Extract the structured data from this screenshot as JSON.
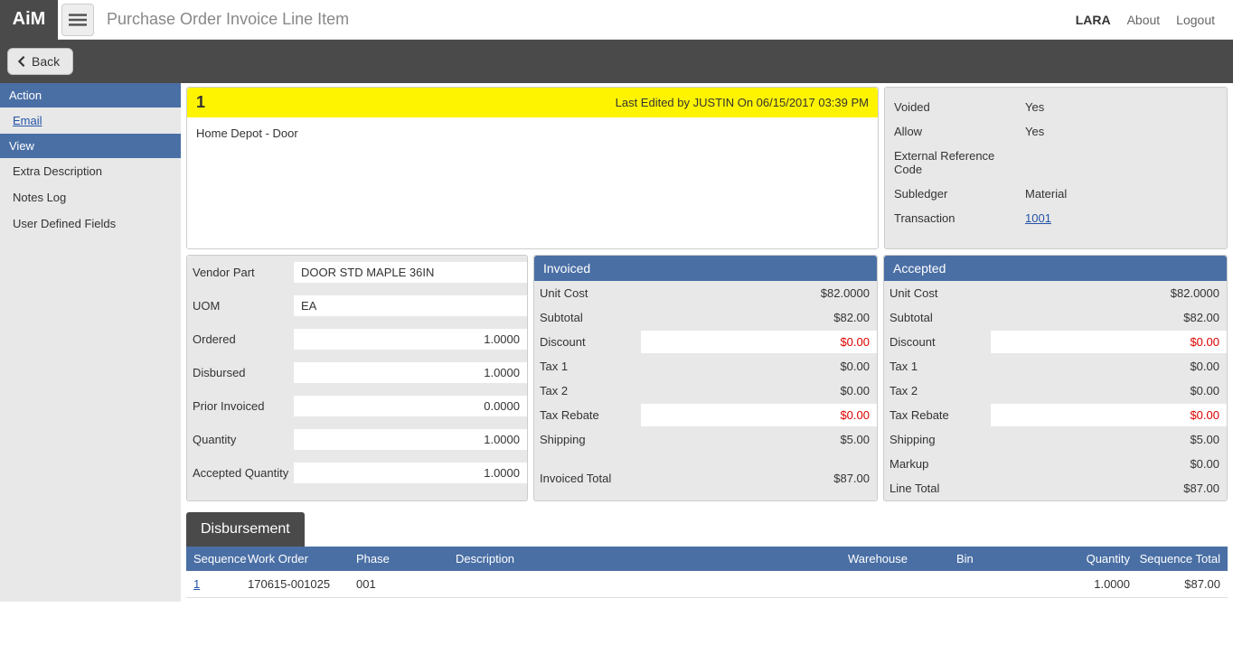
{
  "app": {
    "logo": "AiM",
    "title": "Purchase Order Invoice Line Item"
  },
  "top": {
    "user": "LARA",
    "about": "About",
    "logout": "Logout"
  },
  "back": "Back",
  "sidebar": {
    "action_header": "Action",
    "email": "Email",
    "view_header": "View",
    "extra_desc": "Extra Description",
    "notes_log": "Notes Log",
    "udf": "User Defined Fields"
  },
  "header": {
    "number": "1",
    "edited": "Last Edited by JUSTIN On 06/15/2017 03:39 PM",
    "desc": "Home Depot - Door"
  },
  "info": {
    "voided_l": "Voided",
    "voided_v": "Yes",
    "allow_l": "Allow",
    "allow_v": "Yes",
    "ext_l": "External Reference Code",
    "ext_v": "",
    "sub_l": "Subledger",
    "sub_v": "Material",
    "trans_l": "Transaction",
    "trans_v": "1001"
  },
  "left": {
    "vendor_l": "Vendor Part",
    "vendor_v": "DOOR STD MAPLE 36IN",
    "uom_l": "UOM",
    "uom_v": "EA",
    "ordered_l": "Ordered",
    "ordered_v": "1.0000",
    "disbursed_l": "Disbursed",
    "disbursed_v": "1.0000",
    "prior_l": "Prior Invoiced",
    "prior_v": "0.0000",
    "qty_l": "Quantity",
    "qty_v": "1.0000",
    "acc_l": "Accepted Quantity",
    "acc_v": "1.0000"
  },
  "invoiced": {
    "title": "Invoiced",
    "unit_l": "Unit Cost",
    "unit_v": "$82.0000",
    "sub_l": "Subtotal",
    "sub_v": "$82.00",
    "disc_l": "Discount",
    "disc_v": "$0.00",
    "t1_l": "Tax 1",
    "t1_v": "$0.00",
    "t2_l": "Tax 2",
    "t2_v": "$0.00",
    "tr_l": "Tax Rebate",
    "tr_v": "$0.00",
    "ship_l": "Shipping",
    "ship_v": "$5.00",
    "tot_l": "Invoiced Total",
    "tot_v": "$87.00"
  },
  "accepted": {
    "title": "Accepted",
    "unit_l": "Unit Cost",
    "unit_v": "$82.0000",
    "sub_l": "Subtotal",
    "sub_v": "$82.00",
    "disc_l": "Discount",
    "disc_v": "$0.00",
    "t1_l": "Tax 1",
    "t1_v": "$0.00",
    "t2_l": "Tax 2",
    "t2_v": "$0.00",
    "tr_l": "Tax Rebate",
    "tr_v": "$0.00",
    "ship_l": "Shipping",
    "ship_v": "$5.00",
    "mk_l": "Markup",
    "mk_v": "$0.00",
    "tot_l": "Line Total",
    "tot_v": "$87.00"
  },
  "disb": {
    "title": "Disbursement",
    "h_seq": "Sequence",
    "h_wo": "Work Order",
    "h_ph": "Phase",
    "h_de": "Description",
    "h_wh": "Warehouse",
    "h_bi": "Bin",
    "h_qt": "Quantity",
    "h_st": "Sequence Total",
    "r": {
      "seq": "1",
      "wo": "170615-001025",
      "ph": "001",
      "de": "",
      "wh": "",
      "bi": "",
      "qt": "1.0000",
      "st": "$87.00"
    }
  }
}
